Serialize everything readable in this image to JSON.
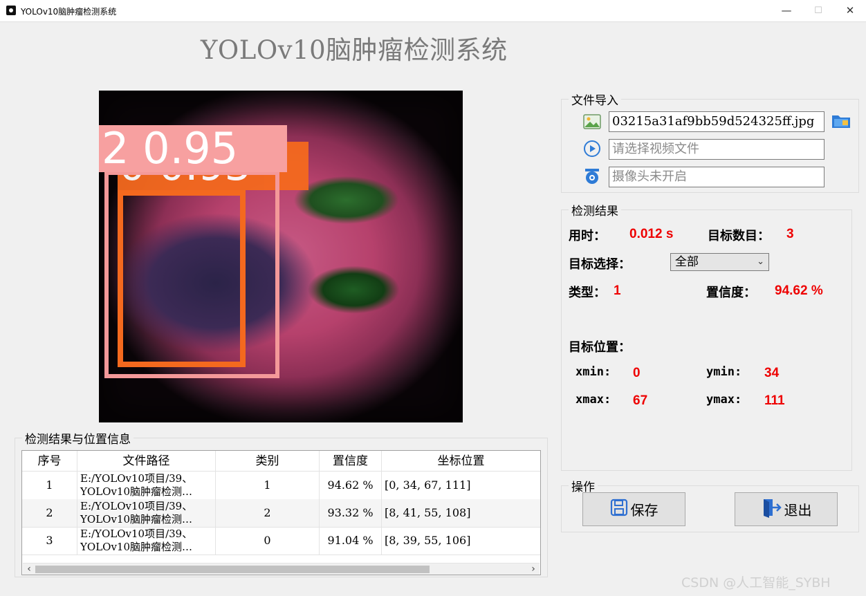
{
  "window": {
    "title": "YOLOv10脑肿瘤检测系统",
    "minimize": "—",
    "maximize": "☐",
    "close": "✕"
  },
  "header": {
    "title": "YOLOv10脑肿瘤检测系统"
  },
  "viewer": {
    "labels": {
      "back": "0 0.93",
      "front": "2 0.95"
    }
  },
  "file_import": {
    "legend": "文件导入",
    "image_path": "03215a31af9bb59d524325ff.jpg",
    "video_placeholder": "请选择视频文件",
    "camera_placeholder": "摄像头未开启",
    "icons": {
      "image": "image-icon",
      "video": "play-circle-icon",
      "camera": "camera-icon",
      "folder": "folder-icon"
    }
  },
  "results": {
    "legend": "检测结果",
    "time_label": "用时：",
    "time_value": "0.012 s",
    "count_label": "目标数目：",
    "count_value": "3",
    "target_select_label": "目标选择：",
    "target_select_value": "全部",
    "class_label": "类型：",
    "class_value": "1",
    "conf_label": "置信度：",
    "conf_value": "94.62 %",
    "position_label": "目标位置：",
    "xmin_label": "xmin:",
    "xmin_value": "0",
    "ymin_label": "ymin:",
    "ymin_value": "34",
    "xmax_label": "xmax:",
    "xmax_value": "67",
    "ymax_label": "ymax:",
    "ymax_value": "111"
  },
  "operations": {
    "legend": "操作",
    "save_label": "保存",
    "exit_label": "退出"
  },
  "table": {
    "legend": "检测结果与位置信息",
    "headers": [
      "序号",
      "文件路径",
      "类别",
      "置信度",
      "坐标位置"
    ],
    "rows": [
      {
        "index": "1",
        "path_line1": "E:/YOLOv10项目/39、",
        "path_line2": "YOLOv10脑肿瘤检测…",
        "cls": "1",
        "conf": "94.62 %",
        "coords": "[0, 34, 67, 111]"
      },
      {
        "index": "2",
        "path_line1": "E:/YOLOv10项目/39、",
        "path_line2": "YOLOv10脑肿瘤检测…",
        "cls": "2",
        "conf": "93.32 %",
        "coords": "[8, 41, 55, 108]"
      },
      {
        "index": "3",
        "path_line1": "E:/YOLOv10项目/39、",
        "path_line2": "YOLOv10脑肿瘤检测…",
        "cls": "0",
        "conf": "91.04 %",
        "coords": "[8, 39, 55, 106]"
      }
    ],
    "scroll_left": "‹",
    "scroll_right": "›"
  },
  "watermark": "CSDN @人工智能_SYBH"
}
